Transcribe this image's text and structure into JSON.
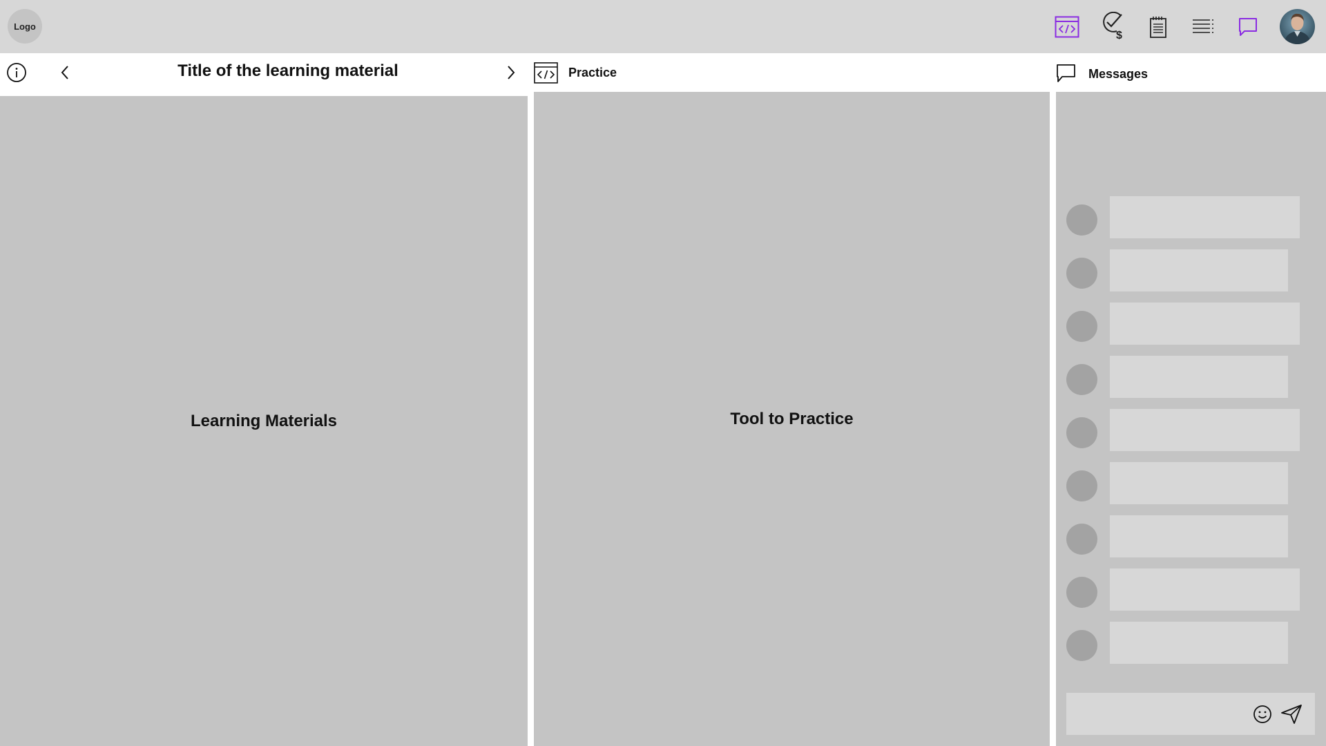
{
  "topbar": {
    "logo_label": "Logo",
    "icons": [
      "code-editor-icon",
      "verified-payment-icon",
      "notepad-icon",
      "list-icon",
      "chat-icon"
    ],
    "accent_color": "#8a2be2"
  },
  "learning": {
    "title": "Title of the learning material",
    "placeholder_label": "Learning Materials"
  },
  "practice": {
    "header_label": "Practice",
    "placeholder_label": "Tool to Practice"
  },
  "messages": {
    "header_label": "Messages",
    "items": [
      {
        "kind": "placeholder-message"
      },
      {
        "kind": "placeholder-message"
      },
      {
        "kind": "placeholder-message"
      },
      {
        "kind": "placeholder-message"
      },
      {
        "kind": "placeholder-message"
      },
      {
        "kind": "placeholder-message"
      },
      {
        "kind": "placeholder-message"
      },
      {
        "kind": "placeholder-message"
      },
      {
        "kind": "placeholder-message"
      }
    ],
    "input_placeholder": ""
  },
  "colors": {
    "topbar_bg": "#d7d7d7",
    "panel_bg": "#c4c4c4",
    "placeholder_avatar": "#a3a3a3"
  }
}
